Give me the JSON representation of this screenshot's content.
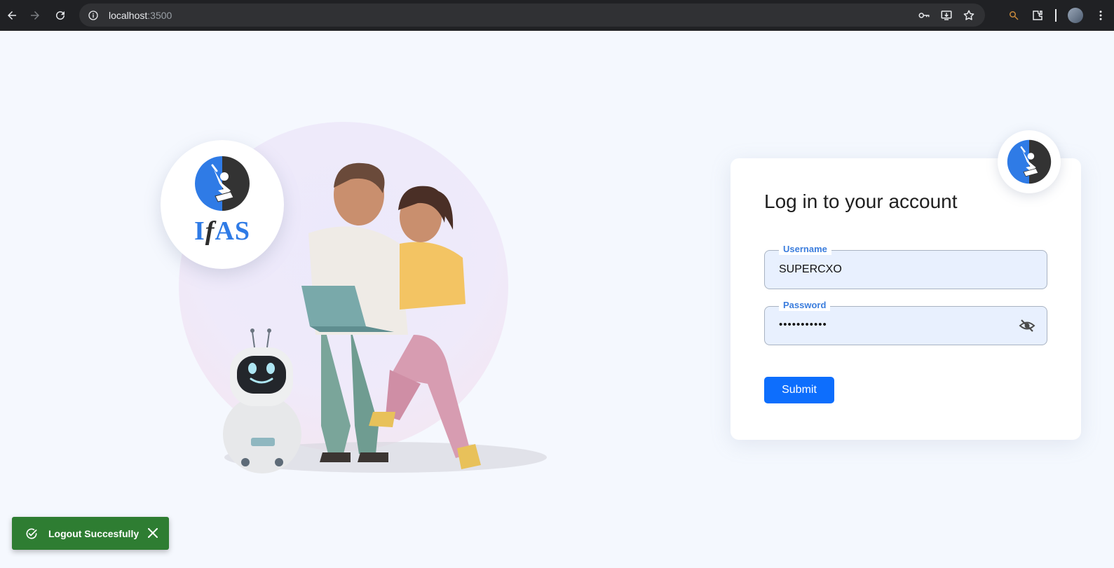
{
  "browser": {
    "url_host": "localhost",
    "url_port": ":3500"
  },
  "brand": {
    "logo_text_before": "I",
    "logo_text_italic": "f",
    "logo_text_after": "AS"
  },
  "login": {
    "title": "Log in to your account",
    "username_label": "Username",
    "username_value": "SUPERCXO",
    "password_label": "Password",
    "password_value": "•••••••••••",
    "submit_label": "Submit"
  },
  "toast": {
    "message": "Logout Succesfully"
  },
  "colors": {
    "primary": "#0d6efd",
    "label_blue": "#3b7ddd",
    "toast_green": "#2e7d32",
    "logo_blue": "#2f7be6"
  }
}
